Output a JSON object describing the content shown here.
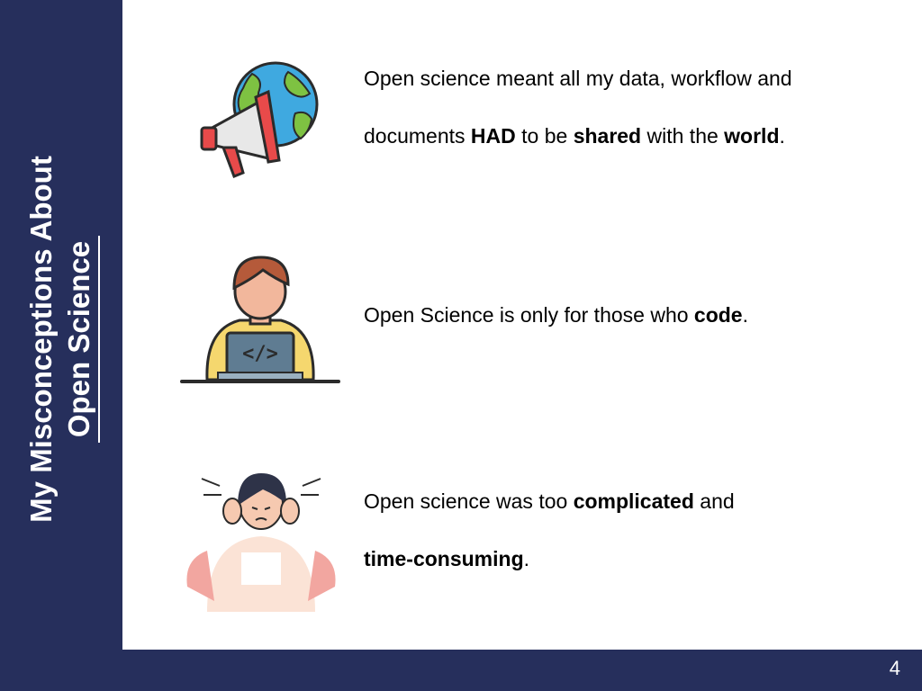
{
  "slide": {
    "title_line1": "My Misconceptions About",
    "title_line2": "Open Science",
    "page_number": "4",
    "colors": {
      "sidebar": "#262f5c",
      "background": "#ffffff",
      "text": "#000000"
    }
  },
  "items": [
    {
      "icon": "megaphone-globe-icon",
      "line1": "Open science meant all my data, workflow and",
      "line2_parts": [
        "documents ",
        "HAD",
        " to be ",
        "shared",
        " with the ",
        "world",
        "."
      ]
    },
    {
      "icon": "developer-laptop-icon",
      "parts": [
        "Open Science is only for those who ",
        "code",
        "."
      ]
    },
    {
      "icon": "stressed-person-icon",
      "line1_parts": [
        "Open science was too ",
        "complicated",
        " and"
      ],
      "line2_parts": [
        "time-consuming",
        "."
      ]
    }
  ]
}
